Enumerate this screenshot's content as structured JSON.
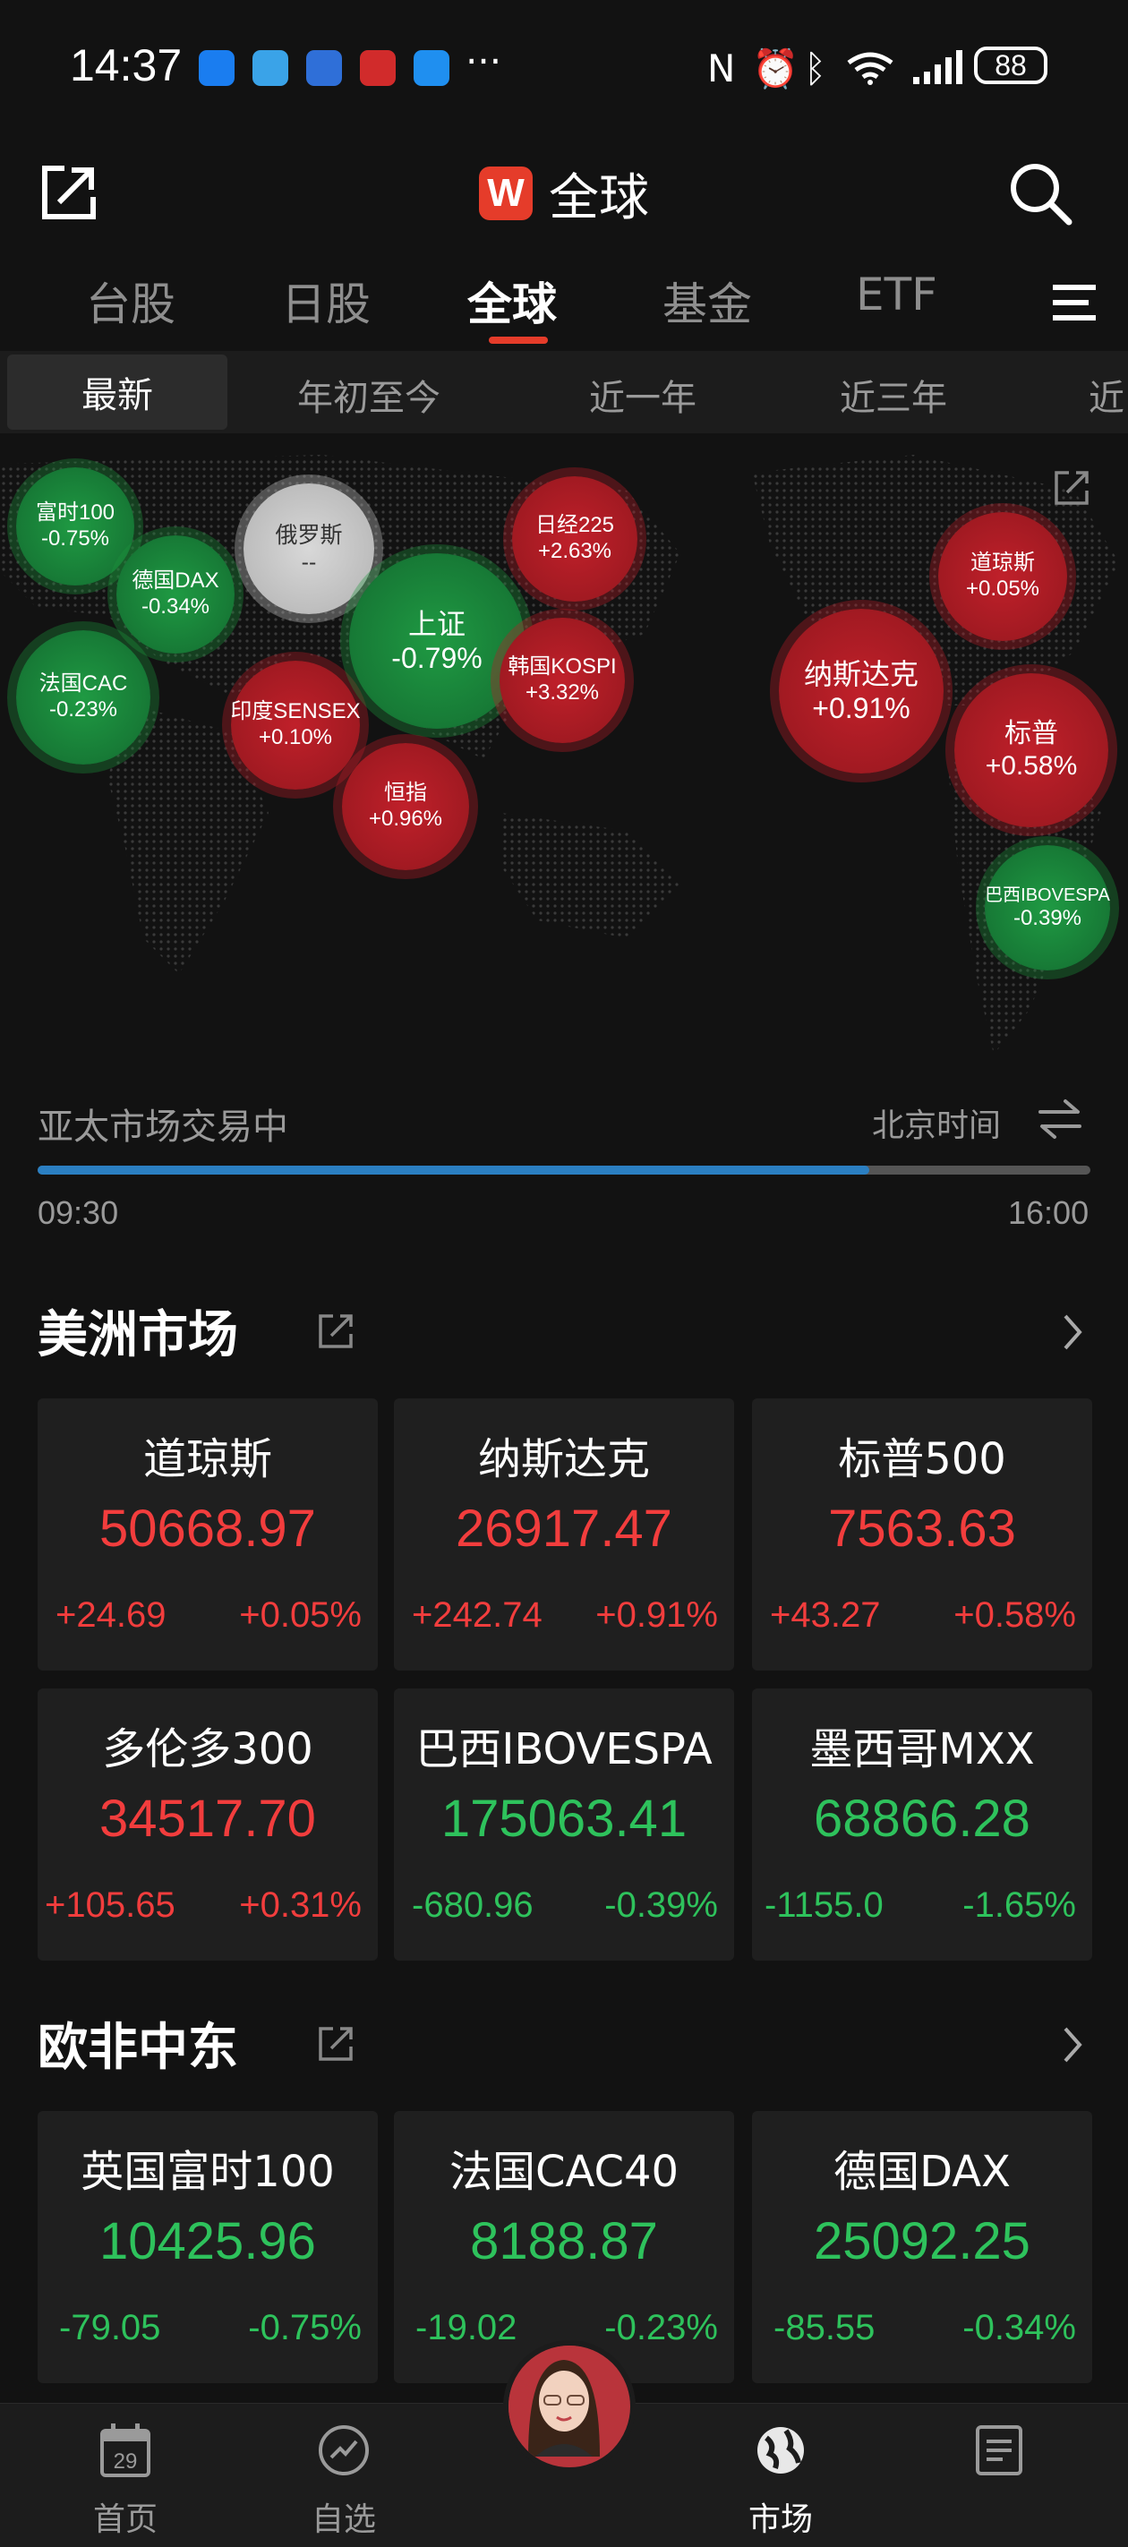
{
  "status_bar": {
    "time": "14:37",
    "battery": "88"
  },
  "header": {
    "logo_letter": "W",
    "title": "全球"
  },
  "tabs": [
    {
      "label": "台股"
    },
    {
      "label": "日股"
    },
    {
      "label": "全球"
    },
    {
      "label": "基金"
    },
    {
      "label": "ETF"
    }
  ],
  "periods": [
    {
      "label": "最新"
    },
    {
      "label": "年初至今"
    },
    {
      "label": "近一年"
    },
    {
      "label": "近三年"
    },
    {
      "label": "近"
    }
  ],
  "map_bubbles": [
    {
      "name": "富时100",
      "change": "-0.75%",
      "trend": "down"
    },
    {
      "name": "俄罗斯",
      "change": "--",
      "trend": "flat"
    },
    {
      "name": "德国DAX",
      "change": "-0.34%",
      "trend": "down"
    },
    {
      "name": "法国CAC",
      "change": "-0.23%",
      "trend": "down"
    },
    {
      "name": "印度SENSEX",
      "change": "+0.10%",
      "trend": "up"
    },
    {
      "name": "上证",
      "change": "-0.79%",
      "trend": "down"
    },
    {
      "name": "日经225",
      "change": "+2.63%",
      "trend": "up"
    },
    {
      "name": "韩国KOSPI",
      "change": "+3.32%",
      "trend": "up"
    },
    {
      "name": "恒指",
      "change": "+0.96%",
      "trend": "up"
    },
    {
      "name": "纳斯达克",
      "change": "+0.91%",
      "trend": "up"
    },
    {
      "name": "道琼斯",
      "change": "+0.05%",
      "trend": "up"
    },
    {
      "name": "标普",
      "change": "+0.58%",
      "trend": "up"
    },
    {
      "name": "巴西IBOVESPA",
      "change": "-0.39%",
      "trend": "down"
    }
  ],
  "trading": {
    "status": "亚太市场交易中",
    "timezone": "北京时间",
    "start": "09:30",
    "end": "16:00",
    "progress": 0.79
  },
  "americas": {
    "title": "美洲市场",
    "cards": [
      {
        "name": "道琼斯",
        "price": "50668.97",
        "change": "+24.69",
        "pct": "+0.05%",
        "trend": "up"
      },
      {
        "name": "纳斯达克",
        "price": "26917.47",
        "change": "+242.74",
        "pct": "+0.91%",
        "trend": "up"
      },
      {
        "name": "标普500",
        "price": "7563.63",
        "change": "+43.27",
        "pct": "+0.58%",
        "trend": "up"
      },
      {
        "name": "多伦多300",
        "price": "34517.70",
        "change": "+105.65",
        "pct": "+0.31%",
        "trend": "up"
      },
      {
        "name": "巴西IBOVESPA",
        "price": "175063.41",
        "change": "-680.96",
        "pct": "-0.39%",
        "trend": "down"
      },
      {
        "name": "墨西哥MXX",
        "price": "68866.28",
        "change": "-1155.0",
        "pct": "-1.65%",
        "trend": "down"
      }
    ]
  },
  "emea": {
    "title": "欧非中东",
    "cards": [
      {
        "name": "英国富时100",
        "price": "10425.96",
        "change": "-79.05",
        "pct": "-0.75%",
        "trend": "down"
      },
      {
        "name": "法国CAC40",
        "price": "8188.87",
        "change": "-19.02",
        "pct": "-0.23%",
        "trend": "down"
      },
      {
        "name": "德国DAX",
        "price": "25092.25",
        "change": "-85.55",
        "pct": "-0.34%",
        "trend": "down"
      }
    ]
  },
  "bottom_nav": [
    {
      "label": "首页",
      "icon_text": "29"
    },
    {
      "label": "自选"
    },
    {
      "label": ""
    },
    {
      "label": "市场"
    },
    {
      "label": ""
    }
  ],
  "colors": {
    "up": "#f23d3d",
    "down": "#2ec25c",
    "accent": "#e53c2a",
    "progress": "#2b7fc2"
  }
}
